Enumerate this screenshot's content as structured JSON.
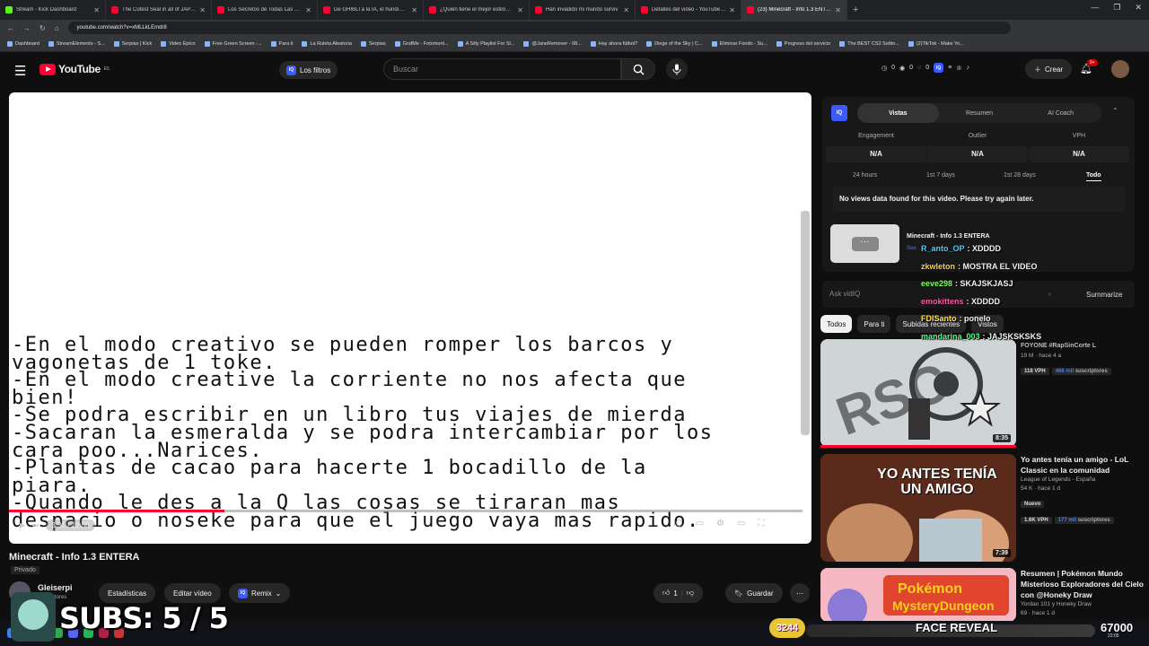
{
  "browser": {
    "tabs": [
      {
        "title": "Stream - Kick Dashboard",
        "kind": "kick"
      },
      {
        "title": "The Cutest Seal in all of JAPAN!",
        "kind": "yt"
      },
      {
        "title": "Los Secretos de Todas Las Estru",
        "kind": "yt"
      },
      {
        "title": "De GHIBLI a la IA, el hundimien",
        "kind": "yt"
      },
      {
        "title": "¿Quién tiene el mejor estilo? Li",
        "kind": "yt"
      },
      {
        "title": "Han invadido mi mundo surviv",
        "kind": "yt"
      },
      {
        "title": "Detalles del video - YouTube St",
        "kind": "yt"
      },
      {
        "title": "(23) Minecraft - Info 1.3 ENTER",
        "kind": "yt",
        "active": true
      }
    ],
    "url": "youtube.com/watch?v=xMLLkLEmdr8",
    "bookmarks": [
      "Dashboard",
      "StreamElements - S...",
      "Serpias | Kick",
      "Video Epico",
      "Free Green Screen -...",
      "Para ti",
      "La Ruleta Aleatoria",
      "Serpias",
      "GrafMe - Fotomont...",
      "A Silly Playlist For Sl...",
      "@JaneRemover - 08...",
      "Hay ahora fútbol?",
      "Diege of the Sky | C...",
      "Eliminar Fondo - Su...",
      "Progreso del servicio",
      "The BEST CS2 Settin...",
      "(2)TikTok - Make Yo..."
    ]
  },
  "header": {
    "logo_text": "YouTube",
    "logo_region": "ES",
    "filters_label": "Los filtros",
    "search_placeholder": "Buscar",
    "stats": [
      "0",
      "0",
      "0"
    ],
    "create_label": "Crear",
    "notif_count": "9+"
  },
  "video": {
    "lines": [
      "-En el modo creativo se pueden romper los barcos y",
      "vagonetas de 1 toke.",
      "-En el modo creative la corriente no nos afecta que",
      "bien!",
      "-Se podra escribir en un libro tus viajes de mierda",
      "-Sacaran la esmeralda y se podra intercambiar por los",
      "cara poo...Narices.",
      "-Plantas de cacao para hacerte 1 bocadillo de la",
      "piara.",
      "-Quando le des a la Q las cosas se tiraran mas",
      "despacio o noseke para que el juego vaya mas rapido."
    ],
    "time": "3:31 / 12:58",
    "progress": 0.272,
    "title": "Minecraft - Info 1.3 ENTERA",
    "privacy": "Privado",
    "channel": "Gleiserpi",
    "subs_label": "suscriptores",
    "stats_btn": "Estadísticas",
    "edit_btn": "Editar vídeo",
    "remix_btn": "Remix",
    "likes": "1",
    "save_btn": "Guardar"
  },
  "vidiq": {
    "tabs": [
      "Vistas",
      "Resumen",
      "AI Coach"
    ],
    "metrics": [
      {
        "label": "Engagement",
        "value": "N/A"
      },
      {
        "label": "Outlier",
        "value": "N/A"
      },
      {
        "label": "VPH",
        "value": "N/A"
      }
    ],
    "ranges": [
      "24 hours",
      "1st 7 days",
      "1st 28 days",
      "Todo"
    ],
    "nodata": "No views data found for this video. Please try again later.",
    "video_title": "Minecraft - Info 1.3 ENTERA",
    "see_label": "See",
    "ask_placeholder": "Ask vidIQ",
    "summarize": "Summarize"
  },
  "chips": [
    "Todos",
    "Para ti",
    "Subidas recientes",
    "Vistos"
  ],
  "chat": [
    {
      "user": "R_anto_OP",
      "msg": "XDDDD",
      "color": "#4ec9ff"
    },
    {
      "user": "zkwleton",
      "msg": "MOSTRA EL VIDEO",
      "color": "#ffd23f"
    },
    {
      "user": "eeve298",
      "msg": "SKAJSKJASJ",
      "color": "#7cff5a"
    },
    {
      "user": "emokittens",
      "msg": "XDDDD",
      "color": "#ff5aa5"
    },
    {
      "user": "FDISanto",
      "msg": "ponelo",
      "color": "#ffe14a"
    },
    {
      "user": "mandarina_003",
      "msg": "JAJSKSKSKS",
      "color": "#4cff88"
    }
  ],
  "recs": [
    {
      "title": "FOYONE #RapSinCorte L",
      "meta": [
        "19 M · hace 4 a"
      ],
      "badges": [
        "118 VPH"
      ],
      "badge_sub": "466 mil",
      "badge_sub_tail": "suscriptores",
      "duration": "8:35"
    },
    {
      "title": "Yo antes tenía un amigo - LoL Classic en la comunidad",
      "meta": [
        "League of Legends - España",
        "54 K · hace 1 d"
      ],
      "new": "Nuevo",
      "badges": [
        "1.6K VPH"
      ],
      "badge_sub": "177 mil",
      "badge_sub_tail": "suscriptores",
      "duration": "7:39",
      "thumb_text": "YO ANTES TENÍA UN AMIGO"
    },
    {
      "title": "Resumen | Pokémon Mundo Misterioso Exploradores del Cielo con @Honeky Draw",
      "meta": [
        "Yordan 101 y Honeky Draw",
        "69 · hace 1 d"
      ],
      "duration": ""
    }
  ],
  "overlay": {
    "subs_text": "SUBS: 5 / 5",
    "coin": "3244",
    "face_reveal": "FACE REVEAL",
    "goal": "67000",
    "clock": "23:05"
  }
}
